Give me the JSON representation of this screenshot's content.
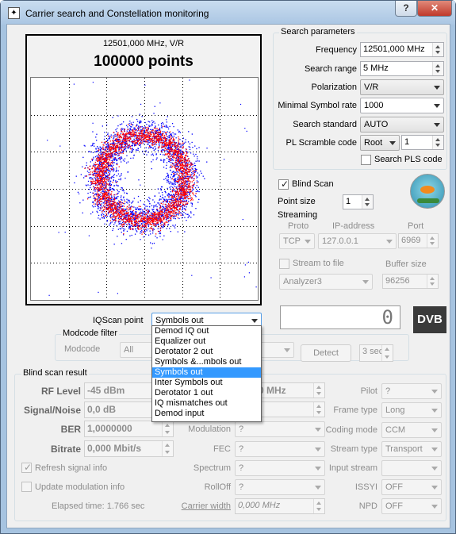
{
  "window": {
    "title": "Carrier search and Constellation monitoring",
    "help_label": "?",
    "close_label": "✕",
    "app_icon": "star-icon"
  },
  "plot": {
    "header": "12501,000 MHz, V/R",
    "points_title": "100000 points",
    "colors": {
      "outer": "#0000ff",
      "inner": "#ff0000",
      "grid": "#000000"
    },
    "chart_data": {
      "type": "scatter",
      "title": "100000 points",
      "subtitle": "12501,000 MHz, V/R",
      "shape": "ring",
      "series": [
        {
          "name": "",
          "color": "#ff0000"
        },
        {
          "name": "",
          "color": "#0000ff"
        }
      ],
      "grid": true
    }
  },
  "search_params": {
    "title": "Search parameters",
    "frequency_label": "Frequency",
    "frequency_value": "12501,000 MHz",
    "range_label": "Search range",
    "range_value": "5 MHz",
    "polarization_label": "Polarization",
    "polarization_value": "V/R",
    "min_sr_label": "Minimal Symbol rate",
    "min_sr_value": "1000",
    "standard_label": "Search standard",
    "standard_value": "AUTO",
    "pls_label": "PL Scramble code",
    "pls_mode": "Root",
    "pls_value": "1",
    "search_pls_label": "Search PLS code"
  },
  "blind_scan": {
    "label": "Blind Scan",
    "checked": true,
    "point_size_label": "Point size",
    "point_size_value": "1"
  },
  "streaming": {
    "title": "Streaming",
    "proto_header": "Proto",
    "ip_header": "IP-address",
    "port_header": "Port",
    "proto_value": "TCP",
    "ip_value": "127.0.0.1",
    "port_value": "6969",
    "stream_to_file_label": "Stream to file",
    "buffer_size_label": "Buffer size",
    "file_value": "Analyzer3",
    "buffer_value": "96256"
  },
  "lcd_value": "0",
  "logo_text": "DVB",
  "iqscan": {
    "label": "IQScan point",
    "selected": "Symbols out",
    "options": [
      "Demod IQ out",
      "Equalizer out",
      "Derotator 2 out",
      "Symbols &...mbols out",
      "Symbols out",
      "Inter Symbols out",
      "Derotator 1 out",
      "IQ mismatches out",
      "Demod input"
    ],
    "selected_index": 4
  },
  "modcode": {
    "title": "Modcode filter",
    "label": "Modcode",
    "value": "All",
    "detect_label": "Detect",
    "timer_value": "3 sec"
  },
  "result": {
    "title": "Blind scan result",
    "rf_label": "RF Level",
    "rf_value": "-45 dBm",
    "sn_label": "Signal/Noise",
    "sn_value": "0,0 dB",
    "ber_label": "BER",
    "ber_value": "1,0000000",
    "bitrate_label": "Bitrate",
    "bitrate_value": "0,000 Mbit/s",
    "freq_value": "0 MHz",
    "modulation_label": "Modulation",
    "modulation_value": "?",
    "fec_label": "FEC",
    "fec_value": "?",
    "spectrum_label": "Spectrum",
    "spectrum_value": "?",
    "rolloff_label": "RollOff",
    "rolloff_value": "?",
    "carrier_width_label": "Carrier width",
    "carrier_width_value": "0,000 MHz",
    "pilot_label": "Pilot",
    "pilot_value": "?",
    "frame_label": "Frame type",
    "frame_value": "Long",
    "coding_label": "Coding mode",
    "coding_value": "CCM",
    "stream_type_label": "Stream type",
    "stream_type_value": "Transport",
    "input_stream_label": "Input stream",
    "input_stream_value": "",
    "issyi_label": "ISSYI",
    "issyi_value": "OFF",
    "npd_label": "NPD",
    "npd_value": "OFF",
    "refresh_label": "Refresh signal info",
    "update_label": "Update modulation info",
    "elapsed": "Elapsed time: 1.766 sec"
  }
}
